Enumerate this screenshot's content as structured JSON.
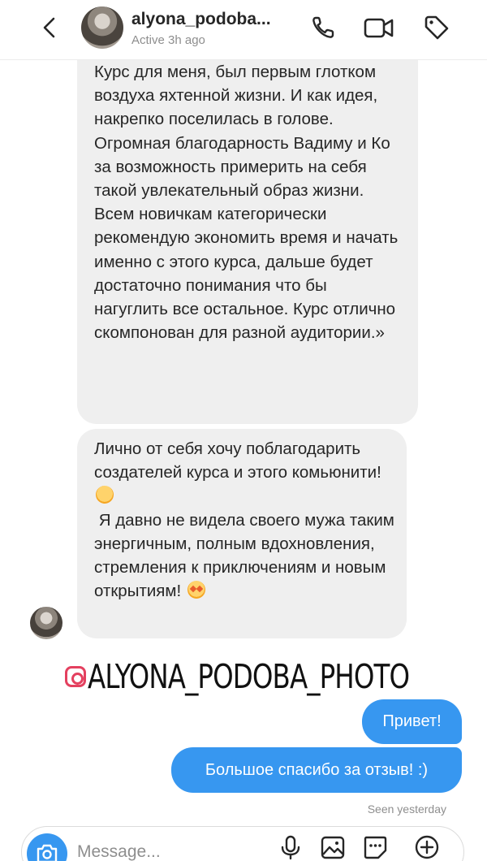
{
  "header": {
    "username": "alyona_podoba...",
    "status": "Active 3h ago",
    "icons": [
      "back-chevron-icon",
      "phone-icon",
      "video-camera-icon",
      "tag-icon"
    ]
  },
  "messages": {
    "received": [
      {
        "paragraphs": [
          "Курс для меня, был первым глотком воздуха яхтенной жизни. И как идея, накрепко поселилась в голове.",
          "Огромная благодарность Вадиму и Ко за возможность примерить на себя такой увлекательный образ жизни. Всем новичкам категорически рекомендую экономить время и начать именно с этого курса, дальше будет достаточно понимания что бы нагуглить все остальное. Курс отлично скомпонован для разной аудитории.»"
        ]
      },
      {
        "text_part1": "Лично от себя хочу поблагодарить создателей курса и этого комьюнити!",
        "emoji1": "hugging-face-emoji",
        "text_part2": "Я давно не видела своего мужа таким энергичным, полным вдохновления, стремления к приключениям и новым открытиям!",
        "emoji2": "star-struck-emoji"
      }
    ],
    "sent": [
      "Привет!",
      "Большое спасибо за отзыв! :)"
    ],
    "seen_status": "Seen yesterday"
  },
  "watermark": {
    "text": "ALYONA_PODOBA_PHOTO",
    "color": "#e4405f"
  },
  "composer": {
    "placeholder": "Message...",
    "icons": [
      "camera-icon",
      "microphone-icon",
      "gallery-icon",
      "sticker-icon",
      "plus-icon"
    ]
  },
  "colors": {
    "accent": "#3797f0",
    "received_bubble": "#efefef",
    "secondary_text": "#8e8e8e"
  }
}
